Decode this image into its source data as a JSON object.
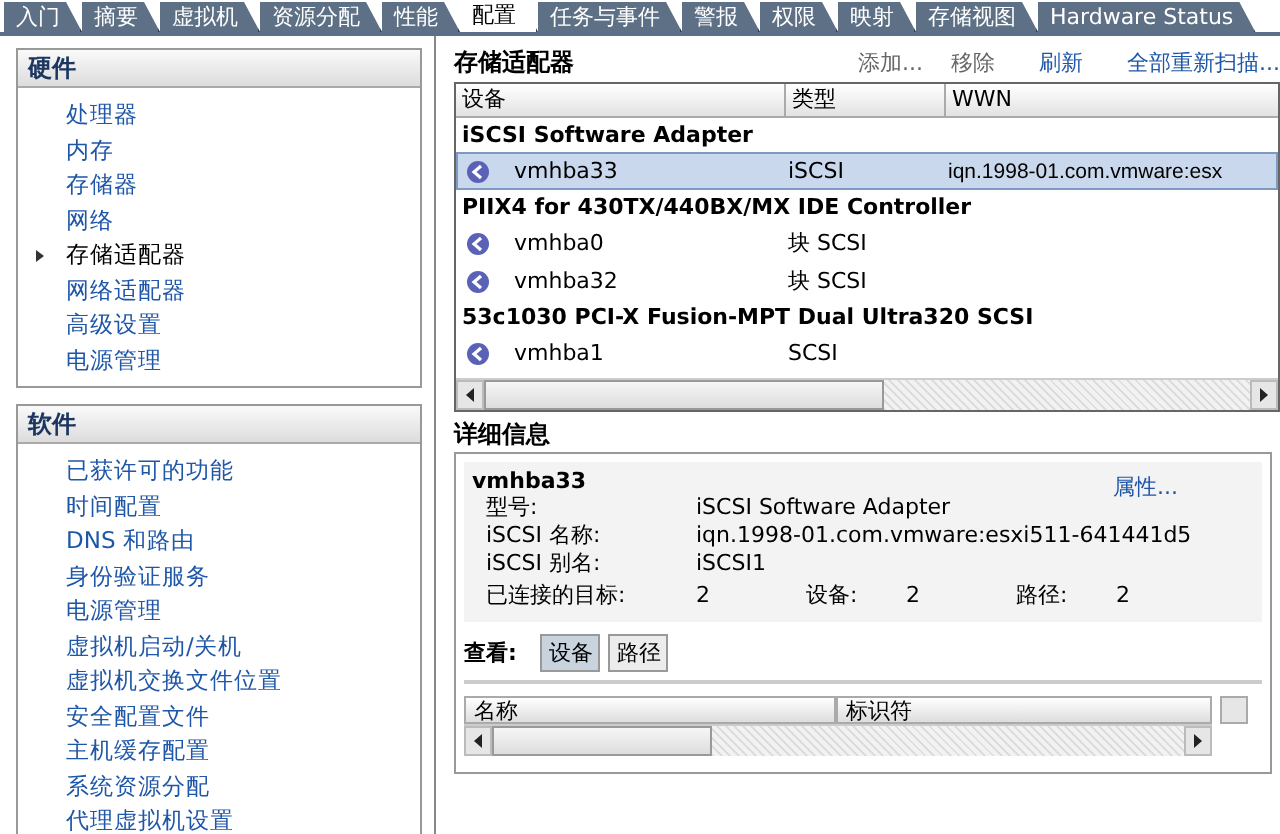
{
  "tabs": [
    {
      "label": "入门",
      "selected": false
    },
    {
      "label": "摘要",
      "selected": false
    },
    {
      "label": "虚拟机",
      "selected": false
    },
    {
      "label": "资源分配",
      "selected": false
    },
    {
      "label": "性能",
      "selected": false
    },
    {
      "label": "配置",
      "selected": true
    },
    {
      "label": "任务与事件",
      "selected": false
    },
    {
      "label": "警报",
      "selected": false
    },
    {
      "label": "权限",
      "selected": false
    },
    {
      "label": "映射",
      "selected": false
    },
    {
      "label": "存储视图",
      "selected": false
    },
    {
      "label": "Hardware Status",
      "selected": false
    }
  ],
  "hardware": {
    "title": "硬件",
    "items": [
      {
        "label": "处理器",
        "selected": false
      },
      {
        "label": "内存",
        "selected": false
      },
      {
        "label": "存储器",
        "selected": false
      },
      {
        "label": "网络",
        "selected": false
      },
      {
        "label": "存储适配器",
        "selected": true
      },
      {
        "label": "网络适配器",
        "selected": false
      },
      {
        "label": "高级设置",
        "selected": false
      },
      {
        "label": "电源管理",
        "selected": false
      }
    ]
  },
  "software": {
    "title": "软件",
    "items": [
      {
        "label": "已获许可的功能",
        "selected": false
      },
      {
        "label": "时间配置",
        "selected": false
      },
      {
        "label": "DNS 和路由",
        "selected": false
      },
      {
        "label": "身份验证服务",
        "selected": false
      },
      {
        "label": "电源管理",
        "selected": false
      },
      {
        "label": "虚拟机启动/关机",
        "selected": false
      },
      {
        "label": "虚拟机交换文件位置",
        "selected": false
      },
      {
        "label": "安全配置文件",
        "selected": false
      },
      {
        "label": "主机缓存配置",
        "selected": false
      },
      {
        "label": "系统资源分配",
        "selected": false
      },
      {
        "label": "代理虚拟机设置",
        "selected": false
      }
    ]
  },
  "adapters": {
    "title": "存储适配器",
    "actions": [
      {
        "label": "添加...",
        "disabled": true
      },
      {
        "label": "移除",
        "disabled": true
      },
      {
        "label": "刷新",
        "disabled": false
      },
      {
        "label": "全部重新扫描...",
        "disabled": false
      }
    ],
    "columns": [
      "设备",
      "类型",
      "WWN"
    ],
    "groups": [
      {
        "name": "iSCSI Software Adapter",
        "rows": [
          {
            "device": "vmhba33",
            "type": "iSCSI",
            "wwn": "iqn.1998-01.com.vmware:esx",
            "selected": true
          }
        ]
      },
      {
        "name": "PIIX4 for 430TX/440BX/MX IDE Controller",
        "rows": [
          {
            "device": "vmhba0",
            "type": "块 SCSI",
            "selected": false
          },
          {
            "device": "vmhba32",
            "type": "块 SCSI",
            "selected": false
          }
        ]
      },
      {
        "name": "53c1030 PCI-X Fusion-MPT Dual Ultra320 SCSI",
        "rows": [
          {
            "device": "vmhba1",
            "type": "SCSI",
            "selected": false
          }
        ]
      }
    ]
  },
  "details": {
    "title": "详细信息",
    "name": "vmhba33",
    "link": "属性...",
    "fields": [
      {
        "label": "型号:",
        "value": "iSCSI Software Adapter"
      },
      {
        "label": "iSCSI 名称:",
        "value": "iqn.1998-01.com.vmware:esxi511-641441d5"
      },
      {
        "label": "iSCSI 别名:",
        "value": "iSCSI1"
      }
    ],
    "counts": [
      {
        "label": "已连接的目标:",
        "value": "2"
      },
      {
        "label": "设备:",
        "value": "2"
      },
      {
        "label": "路径:",
        "value": "2"
      }
    ],
    "view_label": "查看:",
    "view_buttons": [
      {
        "label": "设备",
        "selected": true
      },
      {
        "label": "路径",
        "selected": false
      }
    ],
    "columns": [
      "名称",
      "标识符"
    ]
  }
}
